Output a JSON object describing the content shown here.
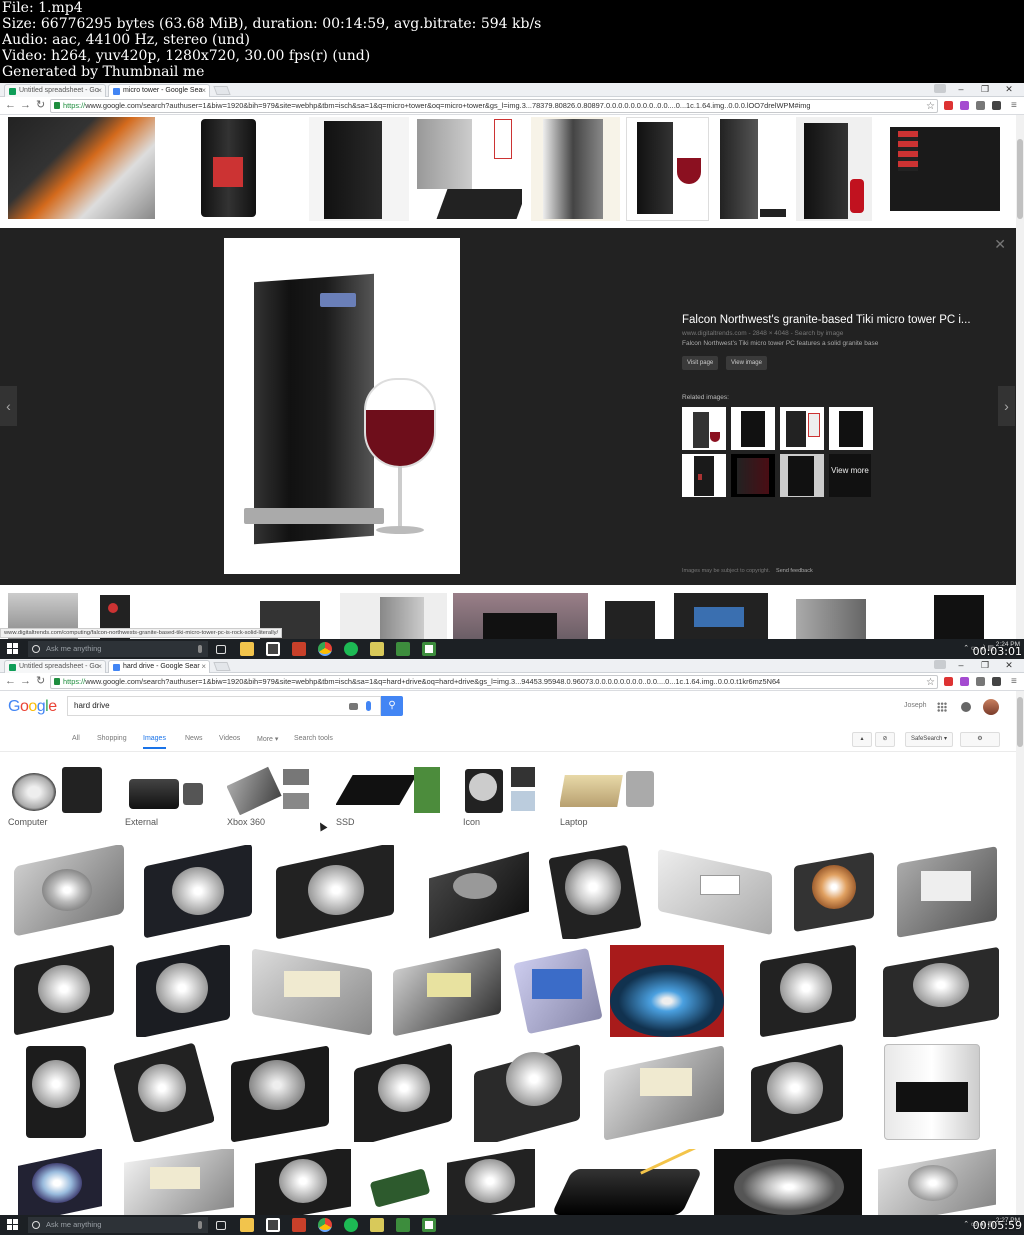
{
  "meta": {
    "file": "File: 1.mp4",
    "size": "Size: 66776295 bytes (63.68 MiB), duration: 00:14:59, avg.bitrate: 594 kb/s",
    "audio": "Audio: aac, 44100 Hz, stereo (und)",
    "video": "Video: h264, yuv420p, 1280x720, 30.00 fps(r) (und)",
    "generator": "Generated by Thumbnail me"
  },
  "shot1": {
    "tabs": [
      {
        "label": "Untitled spreadsheet - Go",
        "favicon_color": "#0f9d58"
      },
      {
        "label": "micro tower - Google Sea",
        "favicon_color": "#4285f4"
      }
    ],
    "url_scheme": "https://",
    "url_rest": "www.google.com/search?authuser=1&biw=1920&bih=979&site=webhp&tbm=isch&sa=1&q=micro+tower&oq=micro+tower&gs_l=img.3...78379.80826.0.80897.0.0.0.0.0.0.0.0..0.0....0...1c.1.64.img..0.0.0.lOO7drelWPM#img",
    "panel": {
      "title": "Falcon Northwest's granite-based Tiki micro tower PC i...",
      "source": "www.digitaltrends.com - 2848 × 4048 - Search by image",
      "description": "Falcon Northwest's Tiki micro tower PC features a solid granite base",
      "visit_button": "Visit page",
      "view_button": "View image",
      "related_label": "Related images:",
      "view_more": "View more",
      "copyright": "Images may be subject to copyright.",
      "feedback": "Send feedback"
    },
    "status_url": "www.digitaltrends.com/computing/falcon-northwests-granite-based-tiki-micro-tower-pc-is-rock-solid-literally/",
    "taskbar_search": "Ask me anything",
    "clock_time": "2:24 PM",
    "timestamp": "00:03:01"
  },
  "shot2": {
    "tabs": [
      {
        "label": "Untitled spreadsheet - Go",
        "favicon_color": "#0f9d58"
      },
      {
        "label": "hard drive - Google Sear",
        "favicon_color": "#4285f4"
      }
    ],
    "url_scheme": "https://",
    "url_rest": "www.google.com/search?authuser=1&biw=1920&bih=979&site=webhp&tbm=isch&sa=1&q=hard+drive&oq=hard+drive&gs_l=img.3...94453.95948.0.96073.0.0.0.0.0.0.0.0..0.0....0...1c.1.64.img..0.0.0.t1kr6mz5N64",
    "logo": [
      "G",
      "o",
      "o",
      "g",
      "l",
      "e"
    ],
    "logo_colors": [
      "#4285f4",
      "#ea4335",
      "#fbbc05",
      "#4285f4",
      "#34a853",
      "#ea4335"
    ],
    "search_value": "hard drive",
    "user": "Joseph",
    "nav": [
      "All",
      "Shopping",
      "Images",
      "News",
      "Videos",
      "More ▾",
      "Search tools"
    ],
    "safesearch": "SafeSearch ▾",
    "chips": [
      "Computer",
      "External",
      "Xbox 360",
      "SSD",
      "Icon",
      "Laptop"
    ],
    "taskbar_search": "Ask me anything",
    "clock_time": "2:27 PM",
    "timestamp": "00:05:59"
  }
}
